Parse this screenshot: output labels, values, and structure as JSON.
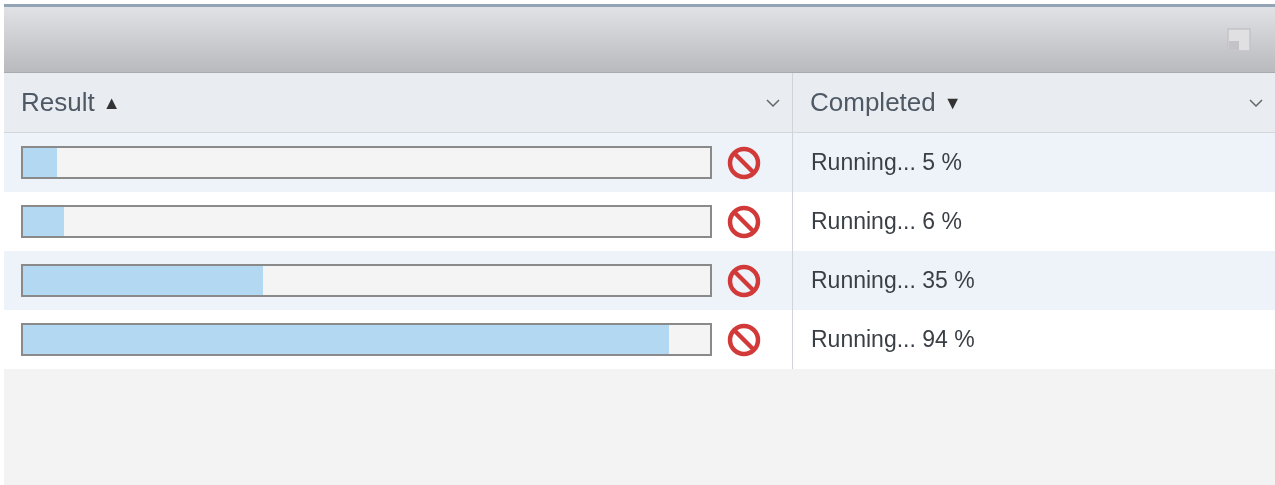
{
  "table": {
    "columns": [
      {
        "label": "Result",
        "sort_indicator": "▲"
      },
      {
        "label": "Completed",
        "sort_indicator": "▼"
      }
    ],
    "rows": [
      {
        "level": 0.05,
        "status": "Running... 5 %"
      },
      {
        "level": 0.06,
        "status": "Running... 6 %"
      },
      {
        "level": 0.35,
        "status": "Running... 35 %"
      },
      {
        "level": 0.94,
        "status": "Running... 94 %"
      }
    ]
  }
}
